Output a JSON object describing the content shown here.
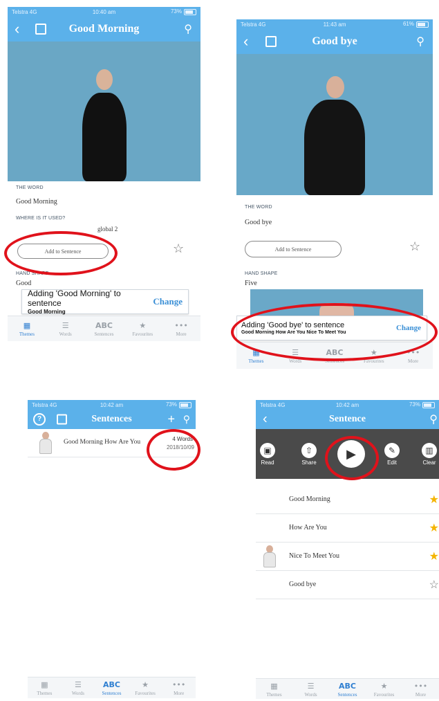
{
  "screen1": {
    "status": {
      "carrier": "Telstra 4G",
      "time": "10:40 am",
      "battery": "73%"
    },
    "nav": {
      "title": "Good Morning",
      "back_icon": "chevron-left-icon",
      "expand_icon": "expand-icon",
      "search_icon": "search-icon"
    },
    "the_word_label": "THE WORD",
    "the_word_value": "Good Morning",
    "where_label": "WHERE IS IT USED?",
    "where_value": "global 2",
    "add_button": "Add to Sentence",
    "hand_shape_label": "HAND SHAPE",
    "hand_shape_value": "Good",
    "toast": {
      "line1": "Adding 'Good Morning' to sentence",
      "line2": "Good Morning",
      "action": "Change"
    }
  },
  "screen2": {
    "status": {
      "carrier": "Telstra 4G",
      "time": "11:43 am",
      "battery": "61%"
    },
    "nav": {
      "title": "Good bye"
    },
    "the_word_label": "THE WORD",
    "the_word_value": "Good bye",
    "add_button": "Add to Sentence",
    "hand_shape_label": "HAND SHAPE",
    "hand_shape_value": "Five",
    "toast": {
      "line1": "Adding 'Good bye' to sentence",
      "line2": "Good Morning How Are You Nice To Meet You",
      "action": "Change"
    }
  },
  "screen3": {
    "status": {
      "carrier": "Telstra 4G",
      "time": "10:42 am",
      "battery": "73%"
    },
    "nav": {
      "title": "Sentences",
      "help_icon": "help-icon",
      "add_icon": "plus-icon"
    },
    "list": [
      {
        "text": "Good Morning How Are You",
        "count": "4 Words",
        "date": "2018/10/09"
      }
    ]
  },
  "screen4": {
    "status": {
      "carrier": "Telstra 4G",
      "time": "10:42 am",
      "battery": "73%"
    },
    "nav": {
      "title": "Sentence"
    },
    "tools": {
      "read": "Read",
      "share": "Share",
      "edit": "Edit",
      "clear": "Clear"
    },
    "words": [
      {
        "text": "Good Morning",
        "favourite": true
      },
      {
        "text": "How Are You",
        "favourite": true
      },
      {
        "text": "Nice To Meet You",
        "favourite": true
      },
      {
        "text": "Good bye",
        "favourite": false
      }
    ]
  },
  "tabs": {
    "themes": "Themes",
    "words": "Words",
    "sentences": "Sentences",
    "sentences_icon": "ABC",
    "favourites": "Favourites",
    "more": "More"
  },
  "colors": {
    "nav_blue": "#5bb1ea",
    "highlight_red": "#e0121b",
    "active_tab": "#2f7fd1",
    "star_gold": "#f4b400"
  }
}
